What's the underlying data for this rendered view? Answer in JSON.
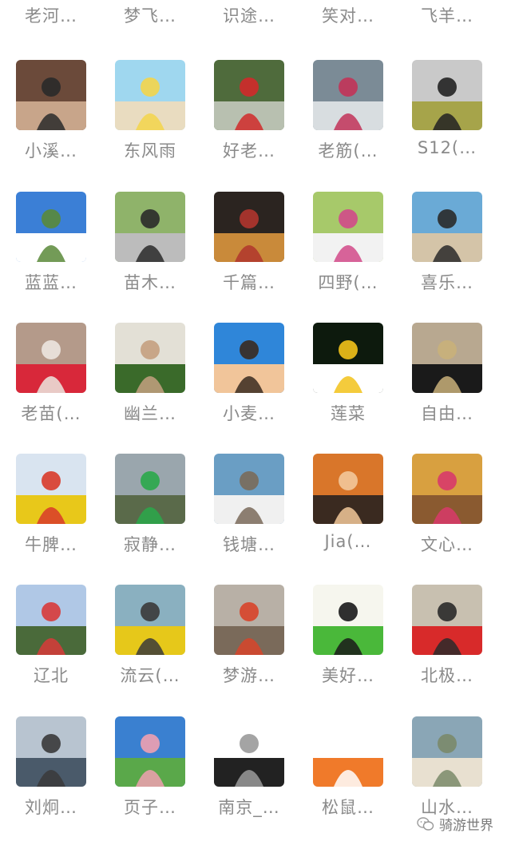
{
  "contacts": [
    {
      "name": "老河…",
      "icon": "avatar-photo",
      "colors": [
        "#ccc"
      ]
    },
    {
      "name": "梦飞…",
      "icon": "avatar-photo",
      "colors": [
        "#ccc"
      ]
    },
    {
      "name": "识途…",
      "icon": "avatar-photo",
      "colors": [
        "#ccc"
      ]
    },
    {
      "name": "笑对…",
      "icon": "avatar-photo",
      "colors": [
        "#ccc"
      ]
    },
    {
      "name": "飞羊…",
      "icon": "avatar-photo",
      "colors": [
        "#ccc"
      ]
    },
    {
      "name": "小溪…",
      "icon": "avatar-photo-person-shop",
      "colors": [
        "#6b4a3a",
        "#c8a58a",
        "#2a2a2a"
      ]
    },
    {
      "name": "东风雨",
      "icon": "avatar-photo-beach",
      "colors": [
        "#9fd7ef",
        "#e9dcc0",
        "#f3d54a"
      ]
    },
    {
      "name": "好老…",
      "icon": "avatar-photo-hiker-mountain",
      "colors": [
        "#4f6b3c",
        "#b8c0b0",
        "#d02a2a"
      ]
    },
    {
      "name": "老筋(…",
      "icon": "avatar-photo-hiker-rocks",
      "colors": [
        "#7b8b96",
        "#d8dde0",
        "#c23358"
      ]
    },
    {
      "name": "S12(…",
      "icon": "avatar-photo-cyclist-field",
      "colors": [
        "#c9c9c9",
        "#a6a44a",
        "#222222"
      ]
    },
    {
      "name": "蓝蓝…",
      "icon": "avatar-photo-great-wall",
      "colors": [
        "#3b7fd6",
        "#ffffff",
        "#5a8a3a"
      ]
    },
    {
      "name": "苗木…",
      "icon": "avatar-photo-cyclist-monument",
      "colors": [
        "#8fb36a",
        "#bcbcbc",
        "#2a2a2a"
      ]
    },
    {
      "name": "千篇…",
      "icon": "avatar-photo-man-hat",
      "colors": [
        "#2b2420",
        "#c98a3a",
        "#b0352d"
      ]
    },
    {
      "name": "四野(…",
      "icon": "avatar-photo-man-sitting-park",
      "colors": [
        "#a7c96a",
        "#f2f2f2",
        "#d24a8a"
      ]
    },
    {
      "name": "喜乐…",
      "icon": "avatar-photo-woman-sea",
      "colors": [
        "#6aaad6",
        "#d4c4a8",
        "#2a2a2a"
      ]
    },
    {
      "name": "老苗(…",
      "icon": "avatar-photo-red-bike",
      "colors": [
        "#b49a8a",
        "#d8283a",
        "#ece6df"
      ]
    },
    {
      "name": "幽兰…",
      "icon": "avatar-photo-woman-tree",
      "colors": [
        "#e3e0d6",
        "#3a6a2a",
        "#c4a080"
      ]
    },
    {
      "name": "小麦…",
      "icon": "avatar-cartoon-boy-glasses",
      "colors": [
        "#2f86d9",
        "#f1c59a",
        "#3a2a20"
      ]
    },
    {
      "name": "莲菜",
      "icon": "avatar-lotus-flower",
      "colors": [
        "#0d1a0d",
        "#ffffff",
        "#f2c21a"
      ]
    },
    {
      "name": "自由…",
      "icon": "avatar-photo-man-flute",
      "colors": [
        "#b8a890",
        "#1a1a1a",
        "#c9b07a"
      ]
    },
    {
      "name": "牛脾…",
      "icon": "avatar-photo-cyclist-flowers",
      "colors": [
        "#d9e4f0",
        "#e8c81a",
        "#d83a2a"
      ]
    },
    {
      "name": "寂静…",
      "icon": "avatar-photo-cyclists-road",
      "colors": [
        "#9aa6ad",
        "#5a6a4a",
        "#2aa84a"
      ]
    },
    {
      "name": "钱塘…",
      "icon": "avatar-photo-man-beach",
      "colors": [
        "#6a9ec4",
        "#f0f0f0",
        "#7a6a5a"
      ]
    },
    {
      "name": "Jia(…",
      "icon": "avatar-photo-photographer-sunset",
      "colors": [
        "#d9762a",
        "#3a2a20",
        "#f2c89a"
      ]
    },
    {
      "name": "文心…",
      "icon": "avatar-photo-autumn-trees",
      "colors": [
        "#d8a040",
        "#8a5a30",
        "#d83a6a"
      ]
    },
    {
      "name": "辽北",
      "icon": "avatar-photo-group-field",
      "colors": [
        "#b0c8e6",
        "#4a6a3a",
        "#d83a3a"
      ]
    },
    {
      "name": "流云(…",
      "icon": "avatar-photo-cyclist-river",
      "colors": [
        "#8ab0c0",
        "#e6c81a",
        "#3a3a3a"
      ]
    },
    {
      "name": "梦游…",
      "icon": "avatar-photo-cyclist-canyon",
      "colors": [
        "#b8b0a6",
        "#7a6a5a",
        "#d8442a"
      ]
    },
    {
      "name": "美好…",
      "icon": "avatar-lotus-leaf-art",
      "colors": [
        "#f6f6ee",
        "#4ab83a",
        "#1a1a1a"
      ]
    },
    {
      "name": "北极…",
      "icon": "avatar-photo-woman-red-wall",
      "colors": [
        "#c8c0b0",
        "#d82a2a",
        "#2a2a2a"
      ]
    },
    {
      "name": "刘炯…",
      "icon": "avatar-photo-bridge-river",
      "colors": [
        "#b8c4d0",
        "#4a5a6a",
        "#3a3a3a"
      ]
    },
    {
      "name": "页子…",
      "icon": "avatar-photo-flowers-sky",
      "colors": [
        "#3a80d0",
        "#5aa84a",
        "#f0a0b0"
      ]
    },
    {
      "name": "南京_…",
      "icon": "avatar-photo-cyclist-silhouette",
      "colors": [
        "#ffffff",
        "#222222",
        "#9a9a9a"
      ]
    },
    {
      "name": "松鼠…",
      "icon": "avatar-cartoon-squirrel",
      "colors": [
        "#ffffff",
        "#f07a2a",
        "#ffffff"
      ]
    },
    {
      "name": "山水…",
      "icon": "avatar-photo-house-lake",
      "colors": [
        "#8aa6b6",
        "#e8e0d0",
        "#7a8a6a"
      ]
    }
  ],
  "watermark": {
    "icon": "wechat-icon",
    "text": "骑游世界"
  }
}
